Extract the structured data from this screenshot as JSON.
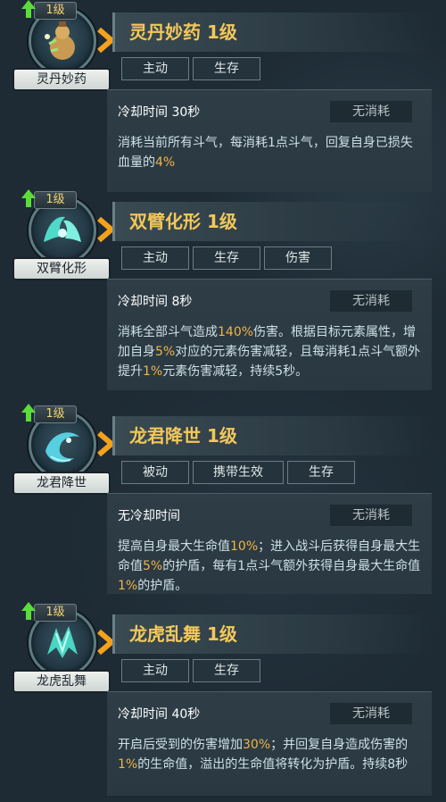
{
  "skills": [
    {
      "level": "1级",
      "icon": "elixir-gourd-icon",
      "name": "灵丹妙药",
      "title": "灵丹妙药 1级",
      "tags": [
        "主动",
        "生存"
      ],
      "cooldown": "冷却时间 30秒",
      "cost": "无消耗",
      "desc": [
        "消耗当前所有斗气，每消耗1点斗气，回复自身已损失血量的",
        "4%",
        ""
      ]
    },
    {
      "level": "1级",
      "icon": "twin-arms-icon",
      "name": "双臂化形",
      "title": "双臂化形 1级",
      "tags": [
        "主动",
        "生存",
        "伤害"
      ],
      "cooldown": "冷却时间 8秒",
      "cost": "无消耗",
      "desc": [
        "消耗全部斗气造成",
        "140%",
        "伤害。根据目标元素属性，增加自身",
        "5%",
        "对应的元素伤害减轻，且每消耗1点斗气额外提升",
        "1%",
        "元素伤害减轻，持续5秒。"
      ]
    },
    {
      "level": "1级",
      "icon": "dragon-descend-icon",
      "name": "龙君降世",
      "title": "龙君降世 1级",
      "tags": [
        "被动",
        "携带生效",
        "生存"
      ],
      "cooldown": "无冷却时间",
      "cost": "无消耗",
      "desc": [
        "提高自身最大生命值",
        "10%",
        "；进入战斗后获得自身最大生命值",
        "5%",
        "的护盾，每有1点斗气额外获得自身最大生命值",
        "1%",
        "的护盾。"
      ]
    },
    {
      "level": "1级",
      "icon": "dragon-tiger-dance-icon",
      "name": "龙虎乱舞",
      "title": "龙虎乱舞 1级",
      "tags": [
        "主动",
        "生存"
      ],
      "cooldown": "冷却时间 40秒",
      "cost": "无消耗",
      "desc": [
        "开启后受到的伤害增加",
        "30%",
        "；并回复自身造成伤害的",
        "1%",
        "的生命值，溢出的生命值将转化为护盾。持续8秒"
      ]
    }
  ],
  "colors": {
    "title": "#f3c85a",
    "highlight": "#f0b548",
    "level_arrow": "#5cdc3a",
    "chevron": "#f4a21e",
    "background": "#1e2b35"
  }
}
